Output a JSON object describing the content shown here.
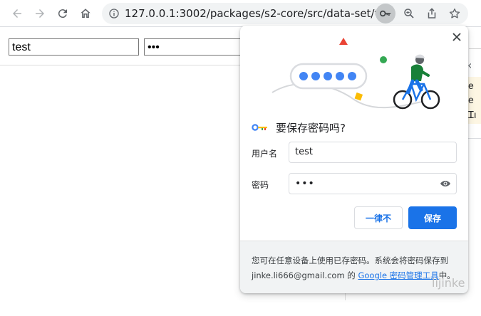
{
  "browser": {
    "url": "127.0.0.1:3002/packages/s2-core/src/data-set/test..."
  },
  "page": {
    "username_value": "test",
    "password_value": "•••"
  },
  "right_panel": {
    "letters": [
      "e",
      "e",
      "Ɪı"
    ]
  },
  "bubble": {
    "title": "要保存密码吗?",
    "username_label": "用户名",
    "username_value": "test",
    "password_label": "密码",
    "password_value": "•••",
    "never_button": "一律不",
    "save_button": "保存",
    "footer_prefix": "您可在任意设备上使用已存密码。系统会将密码保存到 jinke.li666@gmail.com 的 ",
    "footer_link": "Google 密码管理工具",
    "footer_suffix": "中。"
  },
  "watermark": "lijinke",
  "colors": {
    "accent_blue": "#1a73e8",
    "illustration_dot_blue": "#4285f4",
    "illustration_red": "#ea4335",
    "illustration_green": "#34a853",
    "illustration_yellow": "#fbbc04"
  },
  "icons": [
    "back-icon",
    "forward-icon",
    "reload-icon",
    "home-icon",
    "info-icon",
    "key-icon",
    "zoom-icon",
    "share-icon",
    "star-icon",
    "close-icon",
    "google-key-icon",
    "eye-icon"
  ]
}
